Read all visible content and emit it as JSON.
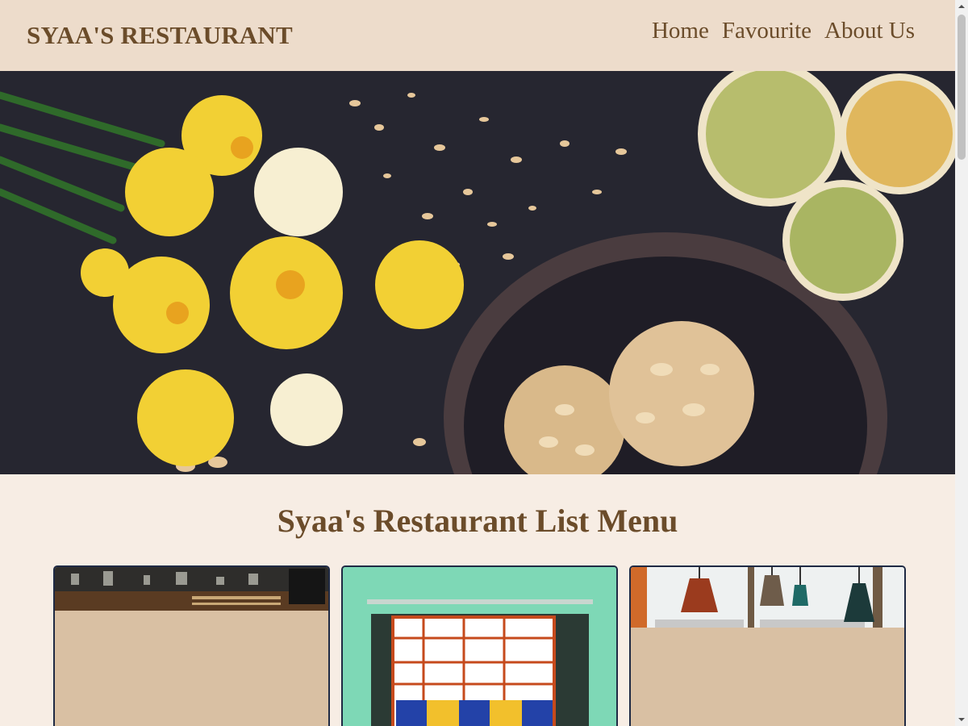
{
  "header": {
    "brand": "SYAA'S RESTAURANT",
    "nav": [
      {
        "label": "Home"
      },
      {
        "label": "Favourite"
      },
      {
        "label": "About Us"
      }
    ]
  },
  "hero": {
    "image": "food-flowers-lemons-photo"
  },
  "menu": {
    "title": "Syaa's Restaurant List Menu",
    "cards": [
      {
        "image": "restaurant-kitchen-photo"
      },
      {
        "image": "restaurant-storefront-photo"
      },
      {
        "image": "pendant-lamps-photo"
      }
    ]
  },
  "colors": {
    "header_bg": "#eddccb",
    "page_bg": "#f7ede4",
    "brand_text": "#6b4c2a",
    "card_bg": "#d9c0a3",
    "card_border": "#1f2a44"
  }
}
